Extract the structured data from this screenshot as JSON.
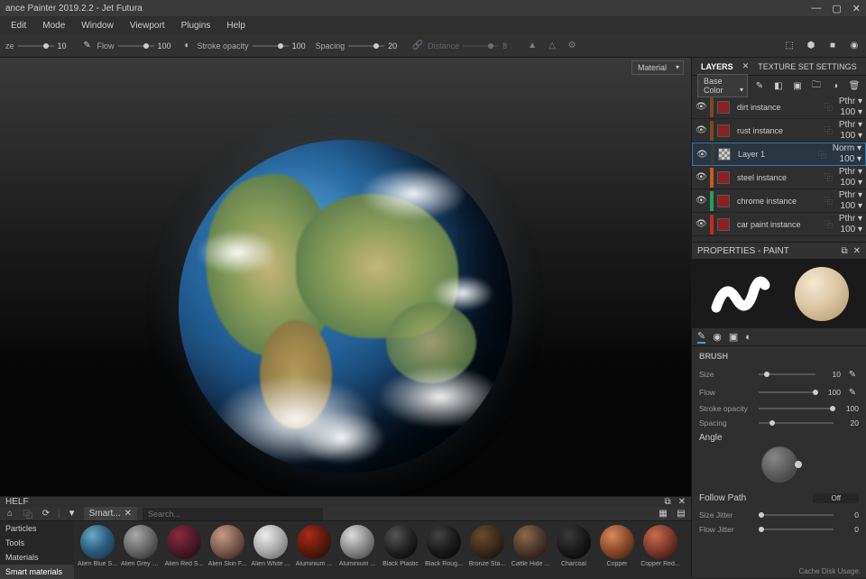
{
  "title": "ance Painter 2019.2.2 - Jet Futura",
  "menu": [
    "Edit",
    "Mode",
    "Window",
    "Viewport",
    "Plugins",
    "Help"
  ],
  "toolbar": {
    "size": {
      "label": "ze",
      "value": "10"
    },
    "flow": {
      "label": "Flow",
      "value": "100"
    },
    "stroke": {
      "label": "Stroke opacity",
      "value": "100"
    },
    "spacing": {
      "label": "Spacing",
      "value": "20"
    },
    "distance": {
      "label": "Distance",
      "value": "8"
    }
  },
  "viewport_dropdown": "Material",
  "panels": {
    "layers": "LAYERS",
    "texset": "TEXTURE SET SETTINGS",
    "channel": "Base Color"
  },
  "layers": [
    {
      "name": "dirt instance",
      "blend": "Pthr",
      "op": "100",
      "color": "#7a4a1a",
      "sel": false
    },
    {
      "name": "rust instance",
      "blend": "Pthr",
      "op": "100",
      "color": "#7a4a1a",
      "sel": false
    },
    {
      "name": "Layer 1",
      "blend": "Norm",
      "op": "100",
      "color": "#3a3a3a",
      "sel": true,
      "checker": true
    },
    {
      "name": "steel instance",
      "blend": "Pthr",
      "op": "100",
      "color": "#c85a1a",
      "sel": false
    },
    {
      "name": "chrome instance",
      "blend": "Pthr",
      "op": "100",
      "color": "#2a9a5a",
      "sel": false
    },
    {
      "name": "car paint instance",
      "blend": "Pthr",
      "op": "100",
      "color": "#c8281a",
      "sel": false
    }
  ],
  "properties": {
    "title": "PROPERTIES - PAINT",
    "brush_heading": "BRUSH",
    "size": {
      "label": "Size",
      "value": "10",
      "pct": 10
    },
    "flow": {
      "label": "Flow",
      "value": "100",
      "pct": 100
    },
    "stroke": {
      "label": "Stroke opacity",
      "value": "100",
      "pct": 100
    },
    "spacing": {
      "label": "Spacing",
      "value": "20",
      "pct": 20
    },
    "angle": {
      "label": "Angle"
    },
    "follow": {
      "label": "Follow Path",
      "value": "Off"
    },
    "sizejitter": {
      "label": "Size Jitter",
      "value": "0",
      "pct": 0
    },
    "flowjitter": {
      "label": "Flow Jitter",
      "value": "0",
      "pct": 0
    }
  },
  "shelf": {
    "title": "HELF",
    "tab": "Smart...",
    "search_placeholder": "Search...",
    "categories": [
      "Particles",
      "Tools",
      "Materials",
      "Smart materials"
    ],
    "active_cat": "Smart materials",
    "items": [
      {
        "name": "Alien Blue S...",
        "g": "radial-gradient(circle at 35% 30%,#6aa8c8,#2a5a7a,#1a2a3a)"
      },
      {
        "name": "Alien Grey S...",
        "g": "radial-gradient(circle at 35% 30%,#aaa,#666,#222)"
      },
      {
        "name": "Alien Red S...",
        "g": "radial-gradient(circle at 35% 30%,#8a2a3a,#4a1a2a,#1a0a0a)"
      },
      {
        "name": "Alien Skin F...",
        "g": "radial-gradient(circle at 35% 30%,#c89a8a,#7a5a4a,#2a1a1a)"
      },
      {
        "name": "Alien White ...",
        "g": "radial-gradient(circle at 35% 30%,#eee,#aaa,#555)"
      },
      {
        "name": "Aluminium ...",
        "g": "radial-gradient(circle at 35% 30%,#a82a1a,#5a1a0a,#1a0a0a)"
      },
      {
        "name": "Aluminium ...",
        "g": "radial-gradient(circle at 35% 30%,#ddd,#888,#333)"
      },
      {
        "name": "Black Plastic",
        "g": "radial-gradient(circle at 35% 30%,#555,#222,#000)"
      },
      {
        "name": "Black Roug...",
        "g": "radial-gradient(circle at 35% 30%,#444,#1a1a1a,#000)"
      },
      {
        "name": "Bronze Sta...",
        "g": "radial-gradient(circle at 35% 30%,#6a4a2a,#3a2a1a,#0a0a0a)"
      },
      {
        "name": "Cattle Hide ...",
        "g": "radial-gradient(circle at 35% 30%,#8a6a4a,#4a3a2a,#1a0a0a)"
      },
      {
        "name": "Charcoal",
        "g": "radial-gradient(circle at 35% 30%,#3a3a3a,#1a1a1a,#000)"
      },
      {
        "name": "Copper",
        "g": "radial-gradient(circle at 35% 30%,#d88a5a,#8a4a2a,#2a1a0a)"
      },
      {
        "name": "Copper Red...",
        "g": "radial-gradient(circle at 35% 30%,#c86a4a,#7a3a2a,#2a0a0a)"
      }
    ]
  },
  "status": "Cache Disk Usage:"
}
